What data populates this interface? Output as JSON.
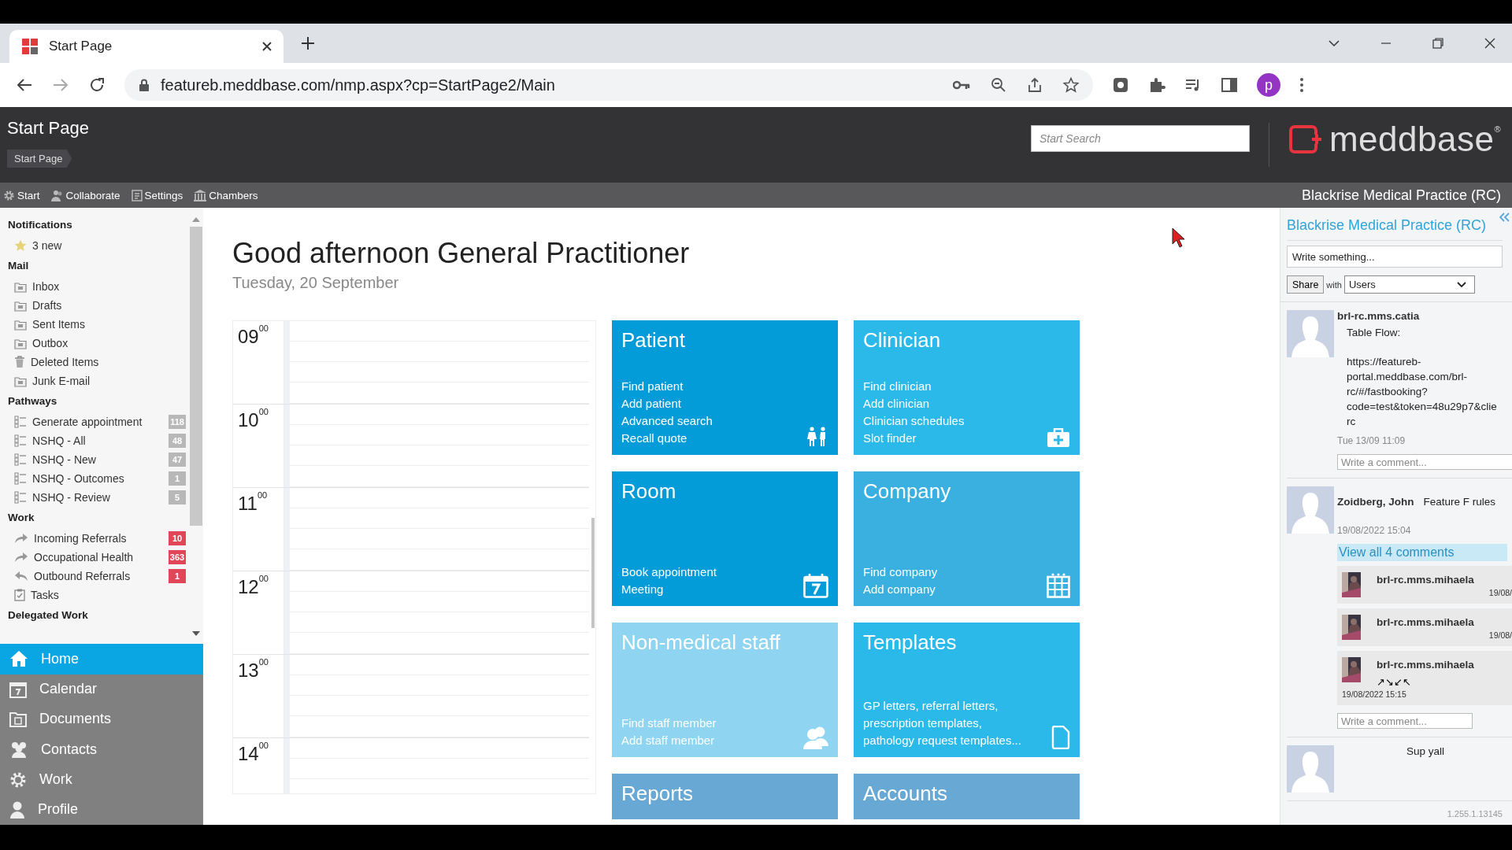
{
  "browser": {
    "tab_title": "Start Page",
    "url": "featureb.meddbase.com/nmp.aspx?cp=StartPage2/Main",
    "profile_initial": "p"
  },
  "header": {
    "title": "Start Page",
    "breadcrumb": "Start Page",
    "search": {
      "placeholder": "Start Search"
    },
    "logo_text": "meddbase$^{®}$"
  },
  "toolbar": {
    "items": [
      {
        "kind": "gear",
        "label": "Start"
      },
      {
        "kind": "people",
        "label": "Collaborate"
      },
      {
        "kind": "settings",
        "label": "Settings"
      },
      {
        "kind": "building",
        "label": "Chambers"
      }
    ],
    "practice": "Blackrise Medical Practice (RC)"
  },
  "sidebar": {
    "sections": [
      {
        "title": "Notifications",
        "items": [
          {
            "kind": "star",
            "label": "3 new"
          }
        ]
      },
      {
        "title": "Mail",
        "items": [
          {
            "kind": "folder",
            "label": "Inbox"
          },
          {
            "kind": "folder",
            "label": "Drafts"
          },
          {
            "kind": "folder",
            "label": "Sent Items"
          },
          {
            "kind": "folder",
            "label": "Outbox"
          },
          {
            "kind": "trash",
            "label": "Deleted Items"
          },
          {
            "kind": "folder",
            "label": "Junk E-mail"
          }
        ]
      },
      {
        "title": "Pathways",
        "items": [
          {
            "kind": "list",
            "label": "Generate appointment",
            "badge": {
              "text": "118",
              "color": "#b8b8b8"
            }
          },
          {
            "kind": "list",
            "label": "NSHQ - All",
            "badge": {
              "text": "48",
              "color": "#b8b8b8"
            }
          },
          {
            "kind": "list",
            "label": "NSHQ - New",
            "badge": {
              "text": "47",
              "color": "#b8b8b8"
            }
          },
          {
            "kind": "list",
            "label": "NSHQ - Outcomes",
            "badge": {
              "text": "1",
              "color": "#b8b8b8"
            }
          },
          {
            "kind": "list",
            "label": "NSHQ - Review",
            "badge": {
              "text": "5",
              "color": "#b8b8b8"
            }
          }
        ]
      },
      {
        "title": "Work",
        "items": [
          {
            "kind": "redo",
            "label": "Incoming Referrals",
            "badge": {
              "text": "10",
              "color": "#e0485a"
            }
          },
          {
            "kind": "redo",
            "label": "Occupational Health",
            "badge": {
              "text": "363",
              "color": "#e0485a"
            }
          },
          {
            "kind": "undo",
            "label": "Outbound Referrals",
            "badge": {
              "text": "1",
              "color": "#e0485a"
            }
          },
          {
            "kind": "clipboard",
            "label": "Tasks"
          }
        ]
      },
      {
        "title": "Delegated Work"
      }
    ],
    "nav": [
      {
        "kind": "home",
        "label": "Home",
        "selected": true
      },
      {
        "kind": "calendar",
        "label": "Calendar",
        "selected": false
      },
      {
        "kind": "documents",
        "label": "Documents",
        "selected": false
      },
      {
        "kind": "contacts",
        "label": "Contacts",
        "selected": false
      },
      {
        "kind": "gear",
        "label": "Work",
        "selected": false
      },
      {
        "kind": "person",
        "label": "Profile",
        "selected": false
      }
    ]
  },
  "greeting": "Good afternoon General Practitioner",
  "date": "Tuesday, 20 September",
  "calendar": {
    "hours": [
      "09$^{00}$",
      "10$^{00}$",
      "11$^{00}$",
      "12$^{00}$",
      "13$^{00}$",
      "14$^{00}$"
    ]
  },
  "tiles": [
    {
      "title": "Patient",
      "color": "#049cd8",
      "kind": "people",
      "links": [
        "Find patient",
        "Add patient",
        "Advanced search",
        "Recall quote"
      ]
    },
    {
      "title": "Clinician",
      "color": "#2bb9ea",
      "kind": "medkit",
      "links": [
        "Find clinician",
        "Add clinician",
        "Clinician schedules",
        "Slot finder"
      ]
    },
    {
      "title": "Room",
      "color": "#049cd8",
      "kind": "calendar",
      "links": [
        "Book appointment",
        "Meeting"
      ]
    },
    {
      "title": "Company",
      "color": "#3ab0e0",
      "kind": "building",
      "links": [
        "Find company",
        "Add company"
      ]
    },
    {
      "title": "Non-medical staff",
      "color": "#8fd5f2",
      "kind": "group",
      "links": [
        "Find staff member",
        "Add staff member"
      ]
    },
    {
      "title": "Templates",
      "color": "#2bb9ea",
      "kind": "document",
      "description": "GP letters, referral letters, prescription templates, pathology request templates..."
    },
    {
      "title": "Reports",
      "color": "#68a8d4"
    },
    {
      "title": "Accounts",
      "color": "#68a8d4"
    }
  ],
  "feed": {
    "title": "Blackrise Medical Practice (RC)",
    "compose": {
      "placeholder": "Write something..."
    },
    "share_button": "Share",
    "with_label": "with",
    "audience": "Users",
    "posts": [
      {
        "author": "brl-rc.mms.catia",
        "lines": [
          "Table Flow:",
          "https://featureb-",
          "portal.meddbase.com/brl-",
          "rc/#/fastbooking?",
          "code=test&token=48u29p7&clie",
          "rc"
        ],
        "time": "Tue 13/09 11:09",
        "comment": {
          "placeholder": "Write a comment..."
        }
      },
      {
        "author": "Zoidberg, John",
        "inline_text": "Feature F rules",
        "time": "19/08/2022 15:04",
        "view_all": "View all 4 comments",
        "replies": [
          {
            "author": "brl-rc.mms.mihaela",
            "time": "19/08/"
          },
          {
            "author": "brl-rc.mms.mihaela",
            "time": "19/08/"
          },
          {
            "author": "brl-rc.mms.mihaela",
            "text": "↗↘↙↖",
            "time": "19/08/2022 15:15"
          }
        ],
        "comment": {
          "placeholder": "Write a comment..."
        }
      },
      {
        "inline_text": "Sup yall"
      }
    ]
  },
  "version": "1.255.1.13145"
}
